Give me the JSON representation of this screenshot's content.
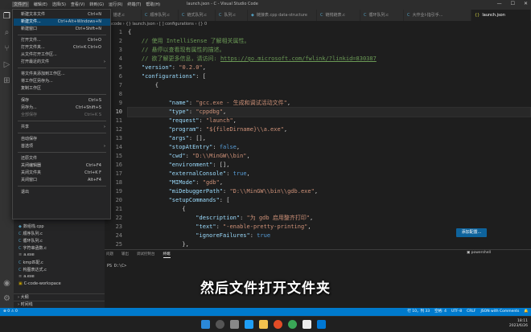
{
  "window": {
    "title": "launch.json - C - Visual Studio Code",
    "menubar": [
      "文件(F)",
      "编辑(E)",
      "选择(S)",
      "查看(V)",
      "转到(G)",
      "运行(R)",
      "终端(T)",
      "帮助(H)"
    ],
    "controls": [
      "—",
      "☐",
      "✕"
    ]
  },
  "file_menu": {
    "items": [
      {
        "label": "新建文本文件",
        "shortcut": "Ctrl+N"
      },
      {
        "label": "新建文件...",
        "shortcut": "Ctrl+Alt+Windows+N"
      },
      {
        "label": "新建窗口",
        "shortcut": "Ctrl+Shift+N"
      },
      {
        "label": "打开文件...",
        "shortcut": "Ctrl+O"
      },
      {
        "label": "打开文件夹...",
        "shortcut": "Ctrl+K Ctrl+O"
      },
      {
        "label": "从文件打开工作区...",
        "shortcut": ""
      },
      {
        "label": "打开最近的文件",
        "shortcut": ""
      },
      {
        "label": "将文件夹添加到工作区...",
        "shortcut": ""
      },
      {
        "label": "将工作区另存为...",
        "shortcut": ""
      },
      {
        "label": "复制工作区",
        "shortcut": ""
      },
      {
        "label": "保存",
        "shortcut": "Ctrl+S"
      },
      {
        "label": "另存为...",
        "shortcut": "Ctrl+Shift+S"
      },
      {
        "label": "全部保存",
        "shortcut": "Ctrl+K S"
      },
      {
        "label": "共享",
        "shortcut": ""
      },
      {
        "label": "自动保存",
        "shortcut": ""
      },
      {
        "label": "首选项",
        "shortcut": ""
      },
      {
        "label": "还原文件",
        "shortcut": ""
      },
      {
        "label": "关闭编辑器",
        "shortcut": "Ctrl+F4"
      },
      {
        "label": "关闭文件夹",
        "shortcut": "Ctrl+K F"
      },
      {
        "label": "关闭窗口",
        "shortcut": "Alt+F4"
      },
      {
        "label": "退出",
        "shortcut": ""
      }
    ]
  },
  "tabs": [
    {
      "label": "描述.c"
    },
    {
      "label": "顺序队列.c"
    },
    {
      "label": "链式队列.c"
    },
    {
      "label": "队列.c"
    },
    {
      "label": "链接表.cpp data-structure"
    },
    {
      "label": "链栈链表.c"
    },
    {
      "label": "循环队列.c"
    },
    {
      "label": "大作业I-指引手..."
    },
    {
      "label": "launch.json"
    }
  ],
  "breadcrumb": ".vscode  ›  {} launch.json  ›  [ ] configurations  ›  {} 0",
  "editor": {
    "line_numbers": [
      1,
      2,
      3,
      4,
      5,
      6,
      7,
      8,
      9,
      10,
      11,
      12,
      13,
      14,
      15,
      16,
      17,
      18,
      19,
      20,
      21,
      22,
      23,
      24,
      25
    ],
    "current_line": 10
  },
  "sidebar_files": [
    {
      "name": "数组栈.cpp"
    },
    {
      "name": "顺序队列.c"
    },
    {
      "name": "循环队列.c"
    },
    {
      "name": "字符串函数.c"
    },
    {
      "name": "a.exe"
    },
    {
      "name": "kmp匹配.c"
    },
    {
      "name": "构图表达式.c"
    },
    {
      "name": "a.exe"
    },
    {
      "name": "C-code-workspace"
    }
  ],
  "sidebar_footer": [
    "大纲",
    "时间线"
  ],
  "panel": {
    "tabs": [
      "问题",
      "输出",
      "调试控制台",
      "终端"
    ],
    "active": "终端",
    "terminal_label": "powershell",
    "prompt": "PS D:\\C>"
  },
  "notification_button": "添加配置...",
  "caption": "然后文件打开文件夹",
  "status_bar": {
    "items": [
      "行 10，列 33",
      "空格: 4",
      "UTF-8",
      "CRLF",
      "JSON with Comments"
    ]
  },
  "taskbar": {
    "time": "18:11",
    "date": "2023/6/26"
  },
  "colors": {
    "accent": "#007acc",
    "menu_highlight": "#094771",
    "key": "#9cdcfe",
    "string": "#ce9178",
    "comment": "#6a9955",
    "keyword": "#569cd6"
  }
}
